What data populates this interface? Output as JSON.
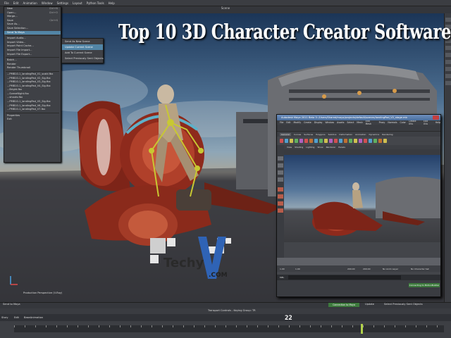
{
  "app": {
    "menubar": [
      "File",
      "Edit",
      "Animation",
      "Window",
      "Settings",
      "Layout",
      "Python Tools",
      "Help"
    ],
    "viewport_title": "Scene",
    "viewport_label": "Production Perspective (V-Ray)",
    "headline": "Top 10 3D Character Creator Software"
  },
  "file_menu": {
    "items": [
      {
        "label": "New",
        "shortcut": "Ctrl+N"
      },
      {
        "label": "Open...",
        "shortcut": "Ctrl+O"
      },
      {
        "label": "Merge...",
        "shortcut": ""
      },
      {
        "label": "Save",
        "shortcut": "Ctrl+S"
      },
      {
        "label": "Save As...",
        "shortcut": ""
      },
      {
        "label": "Save Selection...",
        "shortcut": ""
      },
      {
        "label": "Send To Maya",
        "shortcut": ""
      },
      {
        "label": "Import Audio...",
        "shortcut": ""
      },
      {
        "label": "Import Video...",
        "shortcut": ""
      },
      {
        "label": "Import Point Cache...",
        "shortcut": ""
      },
      {
        "label": "Import File Import...",
        "shortcut": ""
      },
      {
        "label": "Import File Export...",
        "shortcut": ""
      },
      {
        "label": "Batch...",
        "shortcut": ""
      },
      {
        "label": "Render",
        "shortcut": ""
      },
      {
        "label": "Render Thumbnail",
        "shortcut": ""
      },
      {
        "label": "...PMB10-1_landingPad_V1_scald.fbx",
        "shortcut": ""
      },
      {
        "label": "...PMB10-1_landingPad_V2_Sig.fbx",
        "shortcut": ""
      },
      {
        "label": "...PMB10-1_landingPad_V3_Sig.fbx",
        "shortcut": ""
      },
      {
        "label": "...PMB10-1_landingPad_V4_Sig.fbx",
        "shortcut": ""
      },
      {
        "label": "...Bright.fbx",
        "shortcut": ""
      },
      {
        "label": "...SceneNight.fbx",
        "shortcut": ""
      },
      {
        "label": "...shouts.fbx",
        "shortcut": ""
      },
      {
        "label": "...PMB10-1_landingPad_V5_Sig.fbx",
        "shortcut": ""
      },
      {
        "label": "...PMB10-1_landingPad_V6_Sig.fbx",
        "shortcut": ""
      },
      {
        "label": "...PMB10-1_landingPad_V7.fbx",
        "shortcut": ""
      },
      {
        "label": "Properties",
        "shortcut": ""
      },
      {
        "label": "Exit",
        "shortcut": ""
      }
    ],
    "highlighted_index": 6
  },
  "submenu": {
    "items": [
      "Send As New Scene",
      "Update Current Scene",
      "Add To Current Scene",
      "Select Previously Sent Objects"
    ],
    "highlighted_index": 1
  },
  "maya_window": {
    "title": "Autodesk Maya 2011 Beta 3: /Users/Shared/maya/projects/default/scenes/landingPad_V2_stage.mb",
    "menus": [
      "File",
      "Edit",
      "Modify",
      "Create",
      "Display",
      "Window",
      "Assets",
      "Select",
      "Mesh",
      "Edit Mesh",
      "Proxy",
      "Normals",
      "Color",
      "Create UVs",
      "Edit UVs",
      "Help"
    ],
    "mode_selector": "Polygons",
    "shelf_tabs": [
      "General",
      "Curves",
      "Surfaces",
      "Polygons",
      "Subdivs",
      "Deformation",
      "Animation",
      "Dynamics",
      "Rendering"
    ],
    "active_shelf_tab": "General",
    "panel_menus": [
      "View",
      "Shading",
      "Lighting",
      "Show",
      "Renderer",
      "Panels"
    ],
    "range_start": "1.00",
    "range_current": "1.00",
    "range_end": "200.00",
    "range_end2": "200.00",
    "anim_layer": "No Anim Layer",
    "char_set": "No Character Set",
    "cmd_label": "MEL",
    "status_button": "Connecting to MotionBuilder"
  },
  "statusbar": {
    "left": "Send to Maya",
    "connection": "Connection to Maya",
    "mid": "Update",
    "right": "Select Previously Sent Objects"
  },
  "timeline": {
    "header": "Transport Controls - Keying Group: TR",
    "story_label": "Story",
    "edit_label": "Edit",
    "layer_label": "BaseAnimation",
    "frame": "22",
    "end_frame": "200"
  },
  "watermark": {
    "brand": "Techy",
    "suffix": ".COM"
  },
  "colors": {
    "menu_bg": "#3f4146",
    "highlight": "#5285a6",
    "status_green": "#3d7a3d",
    "vehicle_red": "#8e2a1c",
    "rig_yellow": "#c8c832"
  }
}
